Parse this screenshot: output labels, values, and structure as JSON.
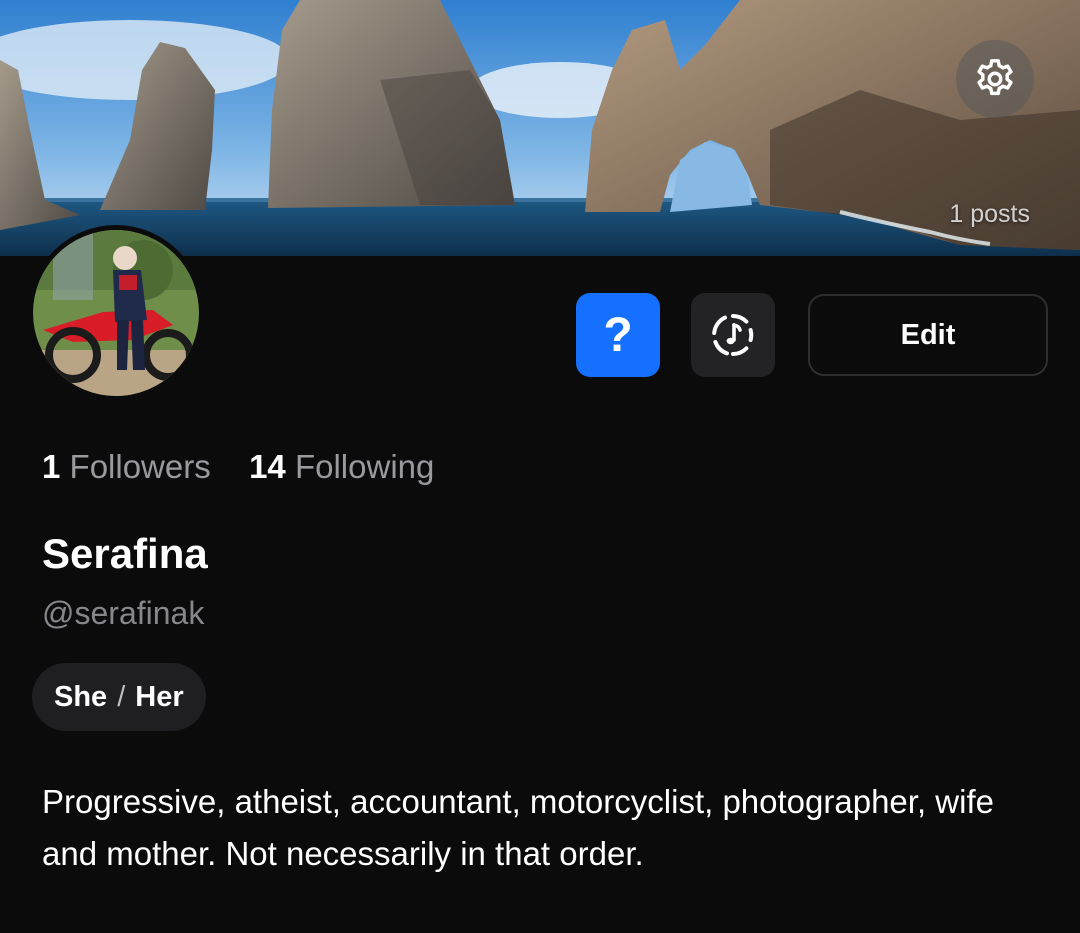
{
  "banner": {
    "posts_label": "1 posts"
  },
  "icons": {
    "settings": "gear-icon",
    "help": "question-mark-icon",
    "music": "music-note-icon"
  },
  "actions": {
    "help_glyph": "?",
    "edit_label": "Edit"
  },
  "stats": {
    "followers_count": "1",
    "followers_label": "Followers",
    "following_count": "14",
    "following_label": "Following"
  },
  "profile": {
    "display_name": "Serafina",
    "handle": "@serafinak",
    "pronoun_subject": "She",
    "pronoun_separator": "/",
    "pronoun_object": "Her",
    "bio": "Progressive, atheist, accountant, motorcyclist, photographer, wife and mother. Not necessarily in that order."
  },
  "colors": {
    "background": "#0b0b0c",
    "accent_blue": "#1570ff",
    "muted_text": "#86868b"
  }
}
